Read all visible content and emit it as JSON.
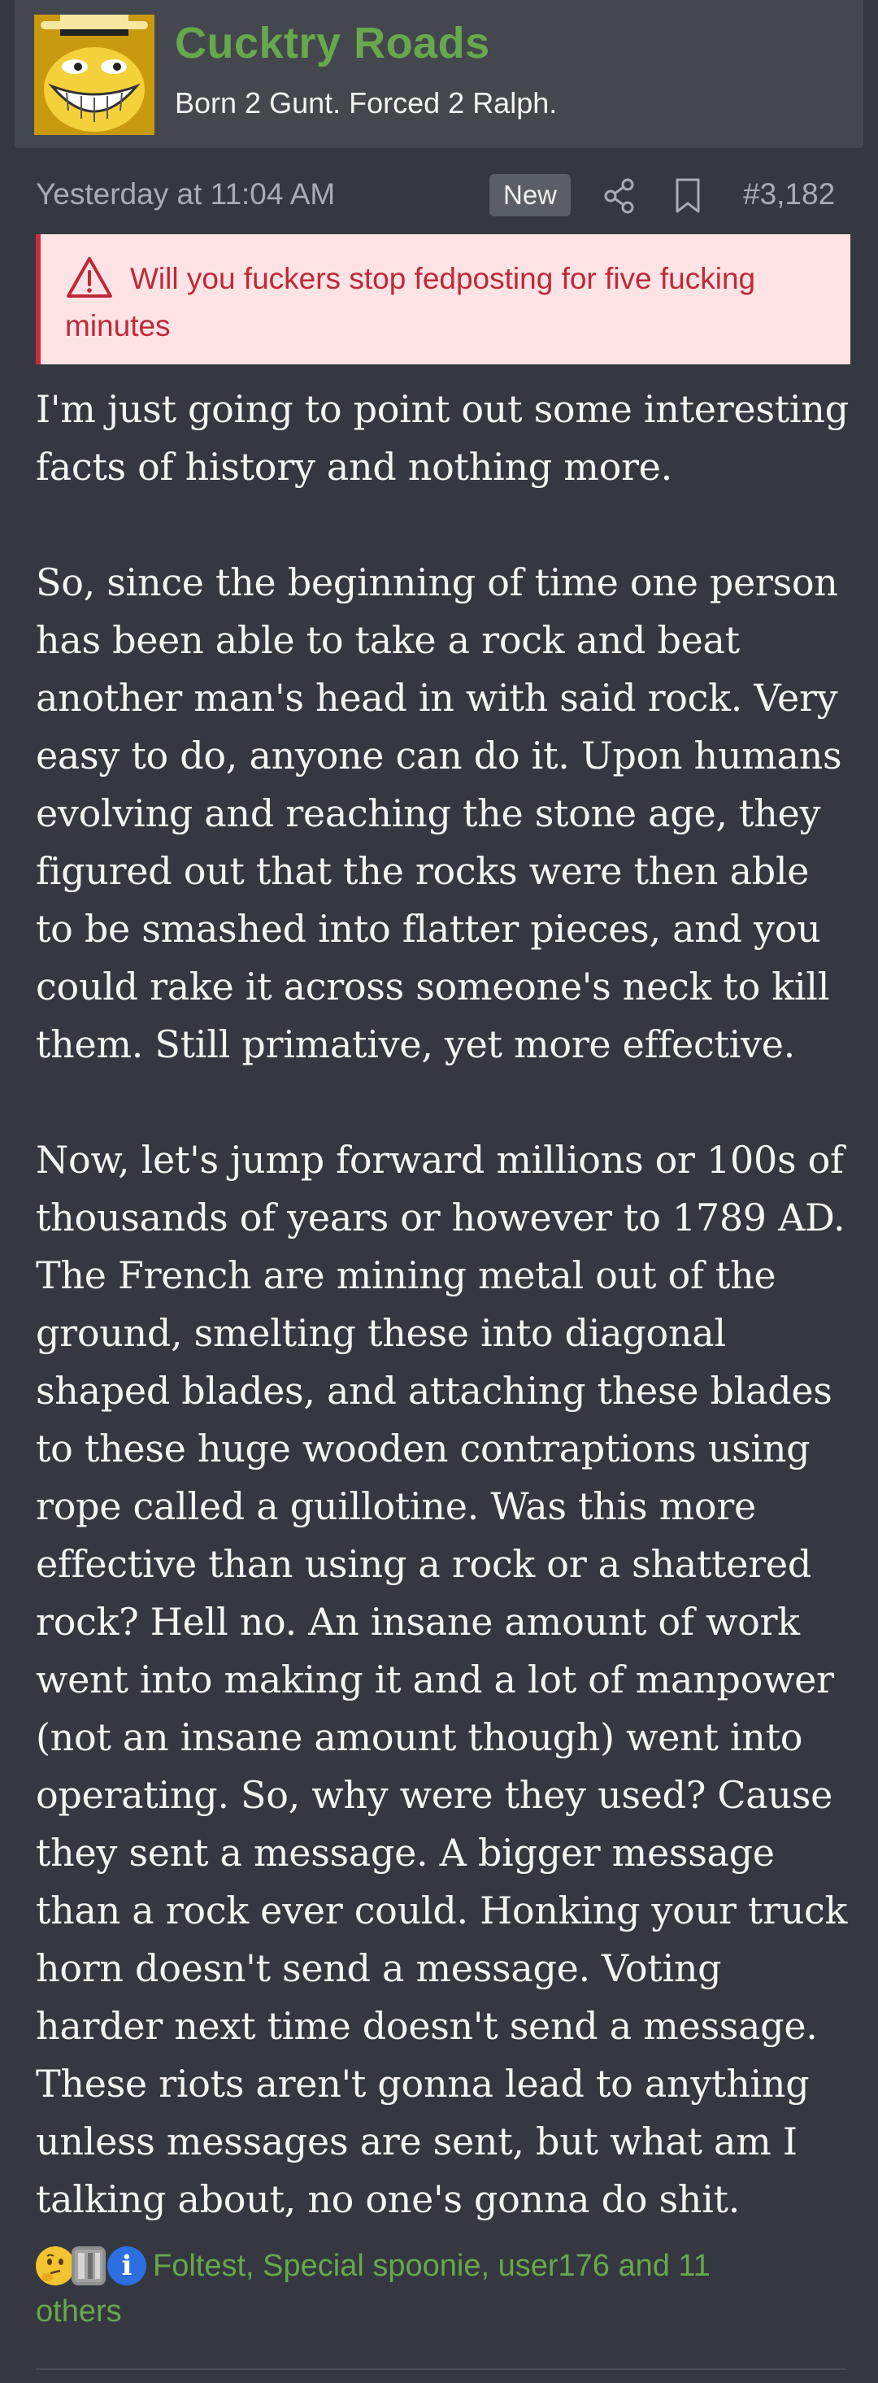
{
  "author": {
    "username": "Cucktry Roads",
    "title": "Born 2 Gunt. Forced 2 Ralph.",
    "avatar_icon": "trollface-avatar-icon"
  },
  "meta": {
    "timestamp": "Yesterday at 11:04 AM",
    "badge": "New",
    "share_icon": "share-icon",
    "bookmark_icon": "bookmark-icon",
    "post_number": "#3,182"
  },
  "warning": {
    "icon": "warning-triangle-icon",
    "text": "Will you fuckers stop fedposting for five fucking minutes"
  },
  "body": {
    "paragraphs": [
      "I'm just going to point out some interesting facts of history and nothing more.",
      "So, since the beginning of time one person has been able to take a rock and beat another man's head in with said rock. Very easy to do, anyone can do it. Upon humans evolving and reaching the stone age, they figured out that the rocks were then able to be smashed into flatter pieces, and you could rake it across someone's neck to kill them. Still primative, yet more effective.",
      "Now, let's jump forward millions or 100s of thousands of years or however to 1789 AD. The French are mining metal out of the ground, smelting these into diagonal shaped blades, and attaching these blades to these huge wooden contraptions using rope called a guillotine. Was this more effective than using a rock or a shattered rock? Hell no. An insane amount of work went into making it and a lot of manpower (not an insane amount though) went into operating. So, why were they used? Cause they sent a message. A bigger message than a rock ever could. Honking your truck horn doesn't send a message. Voting harder next time doesn't send a message. These riots aren't gonna lead to anything unless messages are sent, but what am I talking about, no one's gonna do shit."
    ]
  },
  "reactions": {
    "icons": [
      "thinking-face-icon",
      "book-icon",
      "informative-icon"
    ],
    "info_glyph": "i",
    "text": "Foltest, Special spoonie, user176 and 11 others"
  },
  "colors": {
    "background": "#353840",
    "header": "#44474e",
    "username": "#67a84c",
    "warning_bg": "#fde3e4",
    "warning_text": "#c0283a"
  }
}
